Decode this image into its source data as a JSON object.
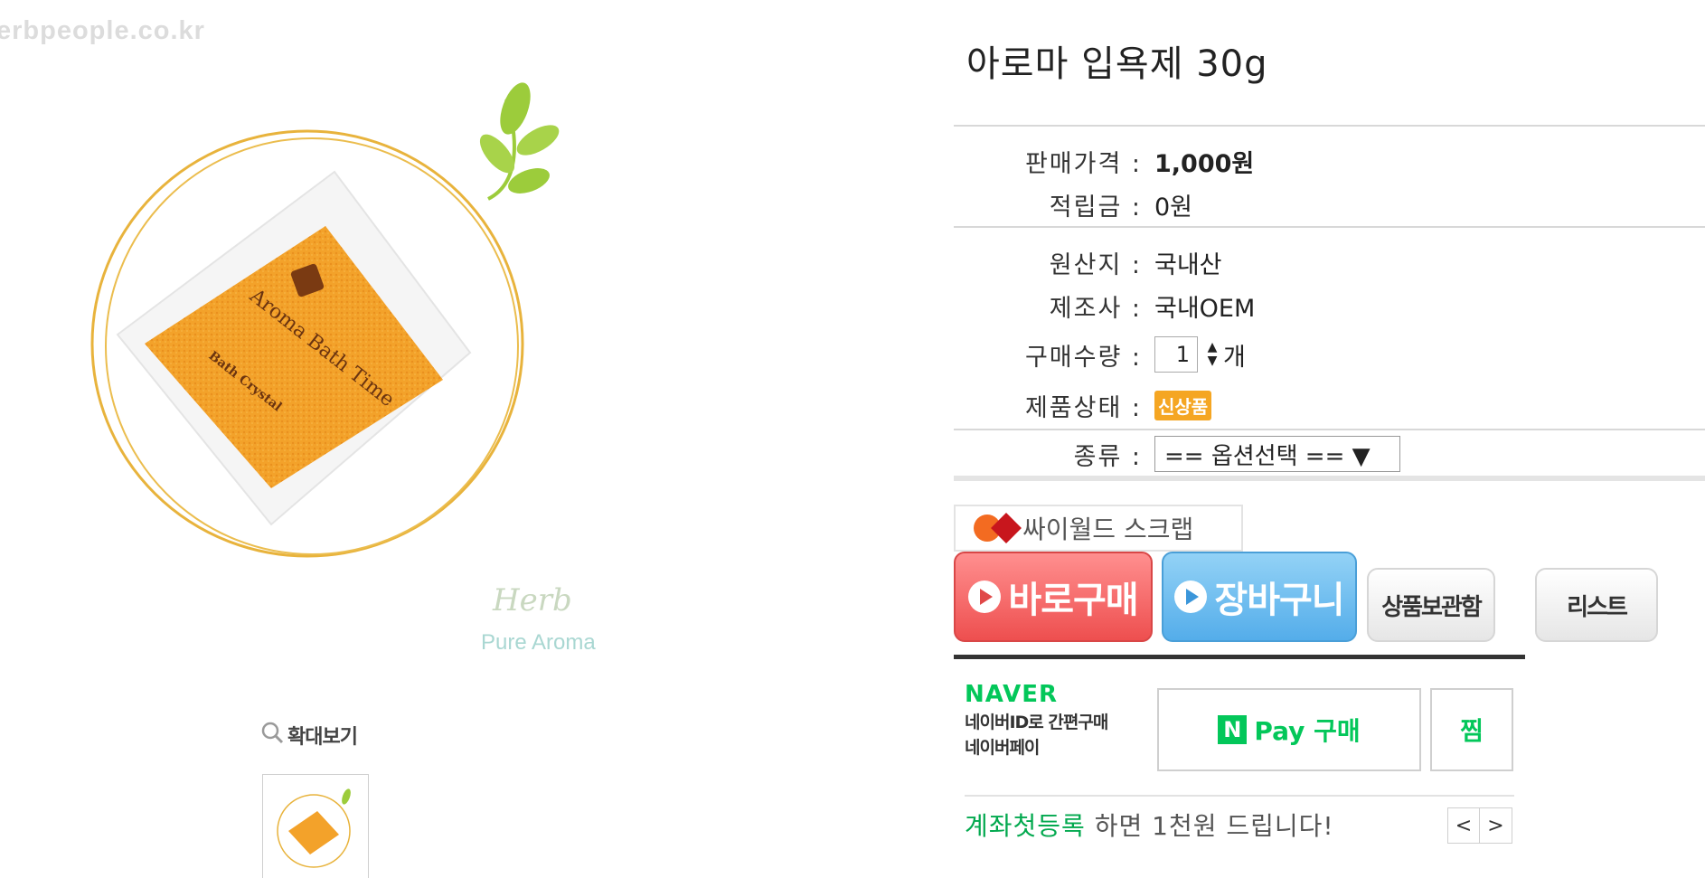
{
  "watermark": "erbpeople.co.kr",
  "image": {
    "package_title": "Aroma Bath Time",
    "package_subtitle": "Bath Crystal",
    "brand_script": "Herb",
    "brand_sub": "Pure Aroma"
  },
  "zoom": {
    "label": "확대보기",
    "icon": "magnifier-icon"
  },
  "product": {
    "title": "아로마 입욕제 30g"
  },
  "info": {
    "price": {
      "label": "판매가격 :",
      "value": "1,000원"
    },
    "points": {
      "label": "적립금 :",
      "value": "0원"
    },
    "origin": {
      "label": "원산지 :",
      "value": "국내산"
    },
    "maker": {
      "label": "제조사 :",
      "value": "국내OEM"
    },
    "quantity": {
      "label": "구매수량 :",
      "value": "1",
      "unit": "개"
    },
    "status": {
      "label": "제품상태 :",
      "badge": "신상품"
    },
    "type": {
      "label": "종류 :",
      "selected": "== 옵션선택 == ▼"
    }
  },
  "buttons": {
    "cyworld": "싸이월드 스크랩",
    "buy_now": "바로구매",
    "cart": "장바구니",
    "wishlist": "상품보관함",
    "list": "리스트"
  },
  "npay": {
    "logo": "NAVER",
    "desc_line1": "네이버ID로 간편구매",
    "desc_line2": "네이버페이",
    "pay_mark": "N",
    "pay_label": "Pay 구매",
    "zzim": "찜"
  },
  "promo": {
    "highlight": "계좌첫등록",
    "text": " 하면 1천원 드립니다!",
    "prev": "<",
    "next": ">"
  },
  "colors": {
    "buy": "#ee4f4f",
    "cart": "#54adea",
    "naver_green": "#03c75a",
    "badge": "#f5a623"
  }
}
